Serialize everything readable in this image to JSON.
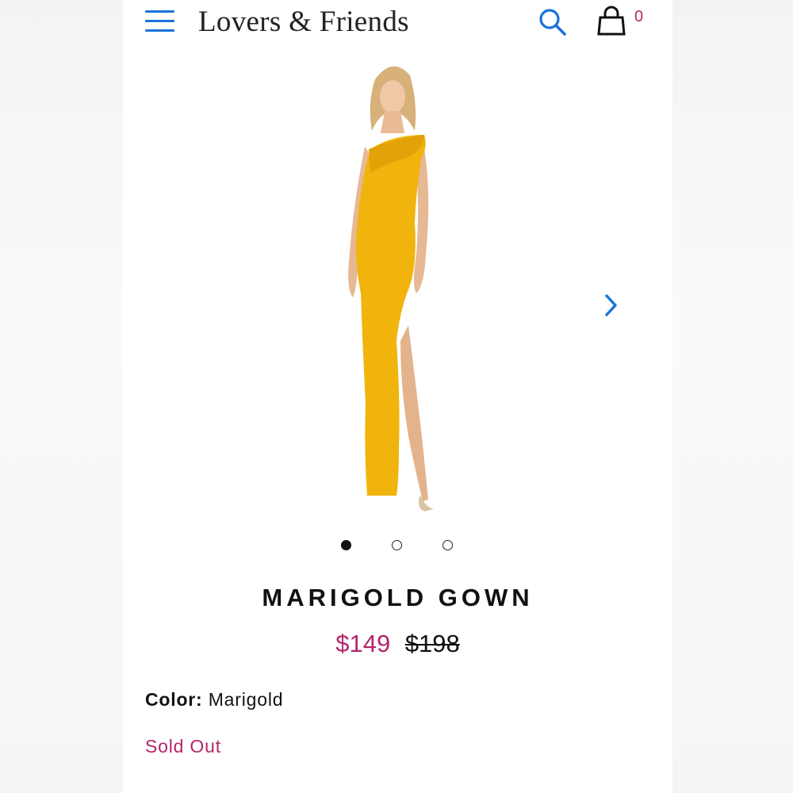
{
  "header": {
    "brand": "Lovers & Friends",
    "cart_count": "0",
    "icons": [
      "menu-icon",
      "search-icon",
      "shopping-bag-icon"
    ],
    "accent_color": "#1a73d9"
  },
  "gallery": {
    "image_subject": "model wearing yellow one-shoulder gown",
    "dot_count": 3,
    "active_dot": 0
  },
  "product": {
    "title": "MARIGOLD GOWN",
    "sale_price": "$149",
    "original_price": "$198",
    "color_label": "Color:",
    "color_value": "Marigold",
    "stock_status": "Sold Out",
    "sale_color": "#b3266b"
  }
}
